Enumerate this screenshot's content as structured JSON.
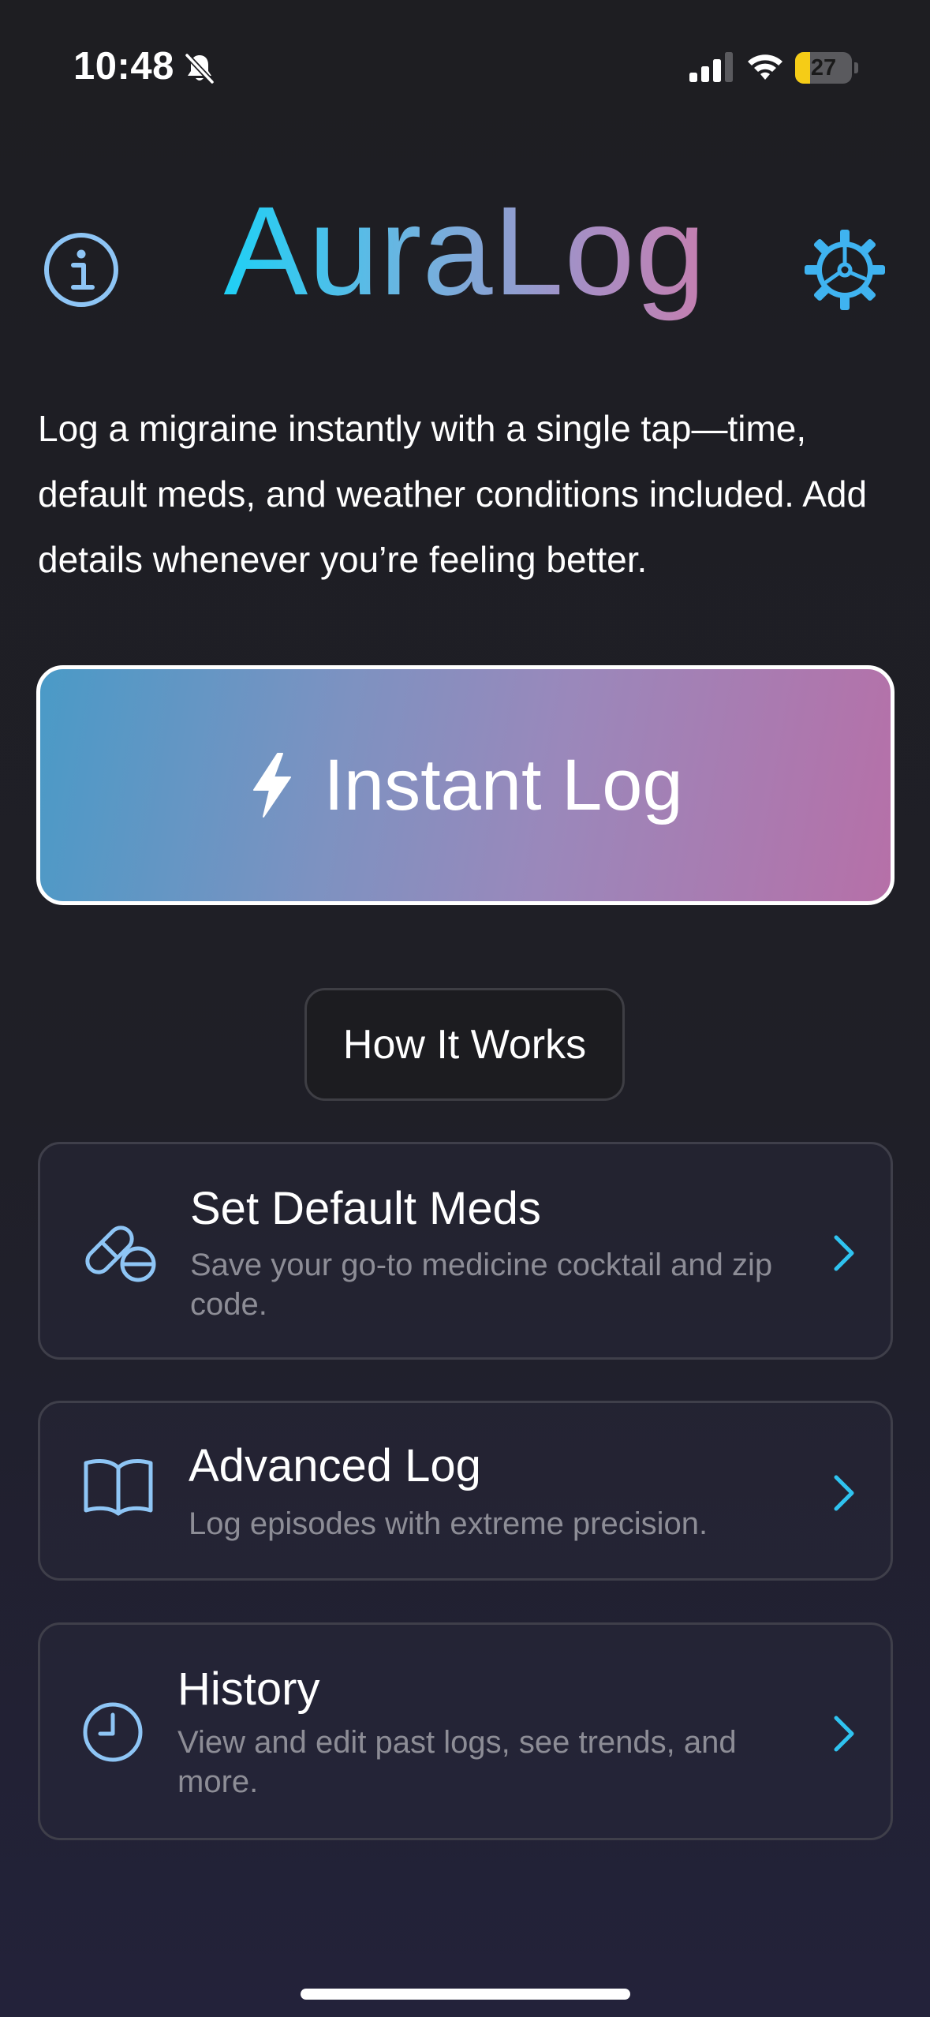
{
  "status_bar": {
    "time": "10:48",
    "battery_level": "27",
    "battery_fraction": 0.27,
    "icons": [
      "bell-slash-icon",
      "cellular-signal-icon",
      "wifi-icon",
      "battery-icon"
    ]
  },
  "header": {
    "title": "AuraLog",
    "left_icon": "info-icon",
    "right_icon": "gear-icon"
  },
  "description": "Log a migraine instantly with a single tap—time, default meds, and weather conditions included. Add details whenever you’re feeling better.",
  "instant_log": {
    "label": "Instant Log",
    "icon": "bolt-icon"
  },
  "how_it_works": {
    "label": "How It Works"
  },
  "menu": [
    {
      "title": "Set Default Meds",
      "subtitle": "Save your go-to medicine cocktail and zip code.",
      "icon": "pills-icon"
    },
    {
      "title": "Advanced Log",
      "subtitle": "Log episodes with extreme precision.",
      "icon": "book-icon"
    },
    {
      "title": "History",
      "subtitle": "View and edit past logs, see trends, and more.",
      "icon": "clock-icon"
    }
  ],
  "colors": {
    "background": "#1e1e22",
    "accent": "#1fd0f5",
    "icon_blue": "#8ec5f5",
    "chevron": "#2fc3f0",
    "gradient_start": "#4a9ac7",
    "gradient_end": "#b670a8",
    "subtitle_gray": "#8d8d96"
  }
}
